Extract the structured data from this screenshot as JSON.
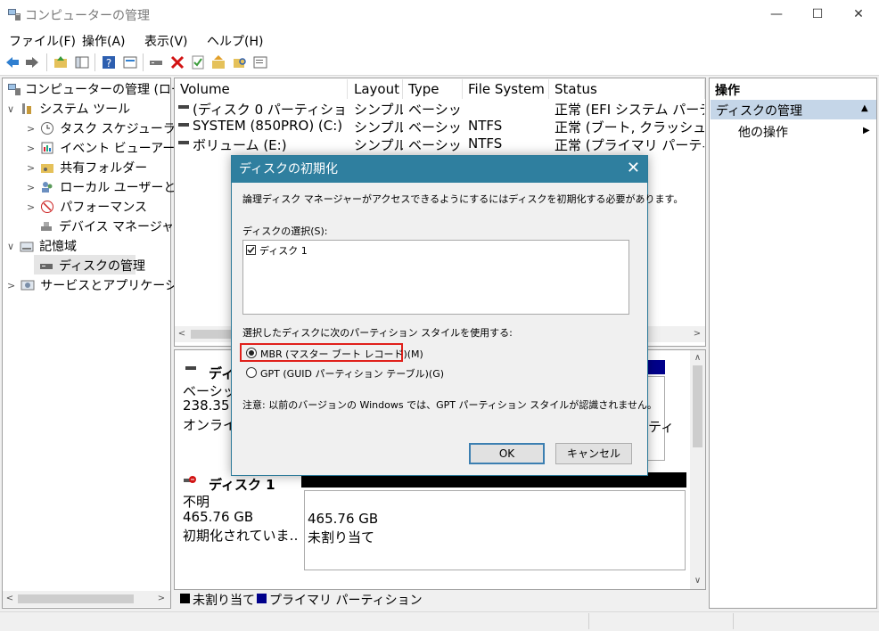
{
  "window": {
    "title": "コンピューターの管理",
    "controls": {
      "minimize": "—",
      "maximize": "☐",
      "close": "✕"
    }
  },
  "menu": [
    "ファイル(F)",
    "操作(A)",
    "表示(V)",
    "ヘルプ(H)"
  ],
  "toolbar": [
    "back-icon",
    "forward-icon",
    "up-folder-icon",
    "show-tree-icon",
    "help-icon",
    "properties-icon",
    "connect-icon",
    "delete-icon",
    "check-icon",
    "folder-up-icon",
    "search-folder-icon",
    "list-icon"
  ],
  "tree": {
    "root": "コンピューターの管理 (ローカ",
    "system_tools": "システム ツール",
    "task_scheduler": "タスク スケジューラ",
    "event_viewer": "イベント ビューアー",
    "shared_folders": "共有フォルダー",
    "local_users": "ローカル ユーザーとグル",
    "performance": "パフォーマンス",
    "device_manager": "デバイス マネージャー",
    "storage": "記憶域",
    "disk_management": "ディスクの管理",
    "services": "サービスとアプリケーション"
  },
  "volume_table": {
    "headers": [
      "Volume",
      "Layout",
      "Type",
      "File System",
      "Status"
    ],
    "rows": [
      [
        "(ディスク 0 パーティション 2)",
        "シンプル",
        "ベーシック",
        "",
        "正常 (EFI システム パーティ"
      ],
      [
        "SYSTEM (850PRO) (C:)",
        "シンプル",
        "ベーシック",
        "NTFS",
        "正常 (ブート, クラッシュ ダン"
      ],
      [
        "ボリューム (E:)",
        "シンプル",
        "ベーシック",
        "NTFS",
        "正常 (プライマリ パーティショ"
      ]
    ]
  },
  "disk0": {
    "name": "ディ",
    "type": "ベーシック",
    "size": "238.35",
    "status": "オンライン",
    "partition_fragment": "ティ"
  },
  "disk1": {
    "name": "ディスク 1",
    "type": "不明",
    "size": "465.76 GB",
    "status": "初期化されていま…",
    "unalloc_size": "465.76 GB",
    "unalloc_label": "未割り当て"
  },
  "legend": {
    "unallocated": "未割り当て",
    "primary": "プライマリ パーティション"
  },
  "actions": {
    "header": "操作",
    "section": "ディスクの管理",
    "other": "他の操作"
  },
  "dialog": {
    "title": "ディスクの初期化",
    "description": "論理ディスク マネージャーがアクセスできるようにするにはディスクを初期化する必要があります。",
    "select_label": "ディスクの選択(S):",
    "disk_item": "ディスク 1",
    "style_label": "選択したディスクに次のパーティション スタイルを使用する:",
    "mbr": "MBR (マスター ブート レコード)(M)",
    "gpt": "GPT (GUID パーティション テーブル)(G)",
    "note": "注意: 以前のバージョンの Windows では、GPT パーティション スタイルが認識されません。",
    "ok": "OK",
    "cancel": "キャンセル",
    "selected_style": "MBR"
  },
  "colors": {
    "dialog_title": "#2f7f9f",
    "highlight_box": "#e0201b",
    "primary_partition": "#00008b",
    "unallocated": "#000000",
    "action_section": "#c5d6e8"
  }
}
